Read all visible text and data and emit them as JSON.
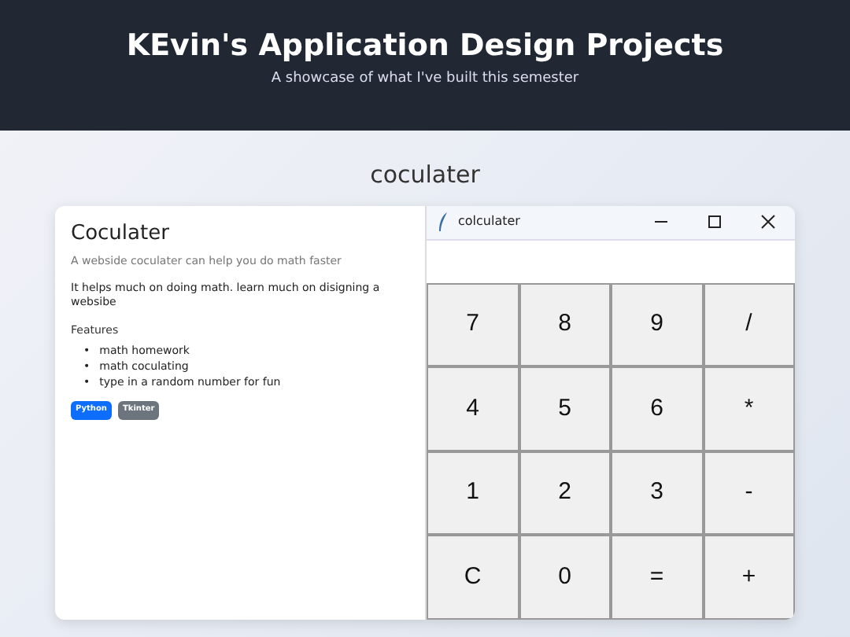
{
  "header": {
    "title": "KEvin's Application Design Projects",
    "subtitle": "A showcase of what I've built this semester"
  },
  "section_title": "coculater",
  "project": {
    "title": "Coculater",
    "subtitle": "A webside coculater can help you do math faster",
    "description": "It helps much on doing math. learn much on disigning a websibe",
    "features_heading": "Features",
    "features": [
      {
        "bullet": "•",
        "text": "math homework"
      },
      {
        "bullet": "•",
        "text": "math coculating"
      },
      {
        "bullet": "•",
        "text": "type in a random number for fun"
      }
    ],
    "tags": [
      {
        "label": "Python",
        "color": "#0d6efd"
      },
      {
        "label": "Tkinter",
        "color": "#6c757d"
      }
    ]
  },
  "app_window": {
    "title": "colculater",
    "controls": [
      {
        "kind": "minimize"
      },
      {
        "kind": "maximize"
      },
      {
        "kind": "close"
      }
    ],
    "keys": [
      [
        "7",
        "8",
        "9",
        "/"
      ],
      [
        "4",
        "5",
        "6",
        "*"
      ],
      [
        "1",
        "2",
        "3",
        "-"
      ],
      [
        "C",
        "0",
        "=",
        "+"
      ]
    ]
  }
}
